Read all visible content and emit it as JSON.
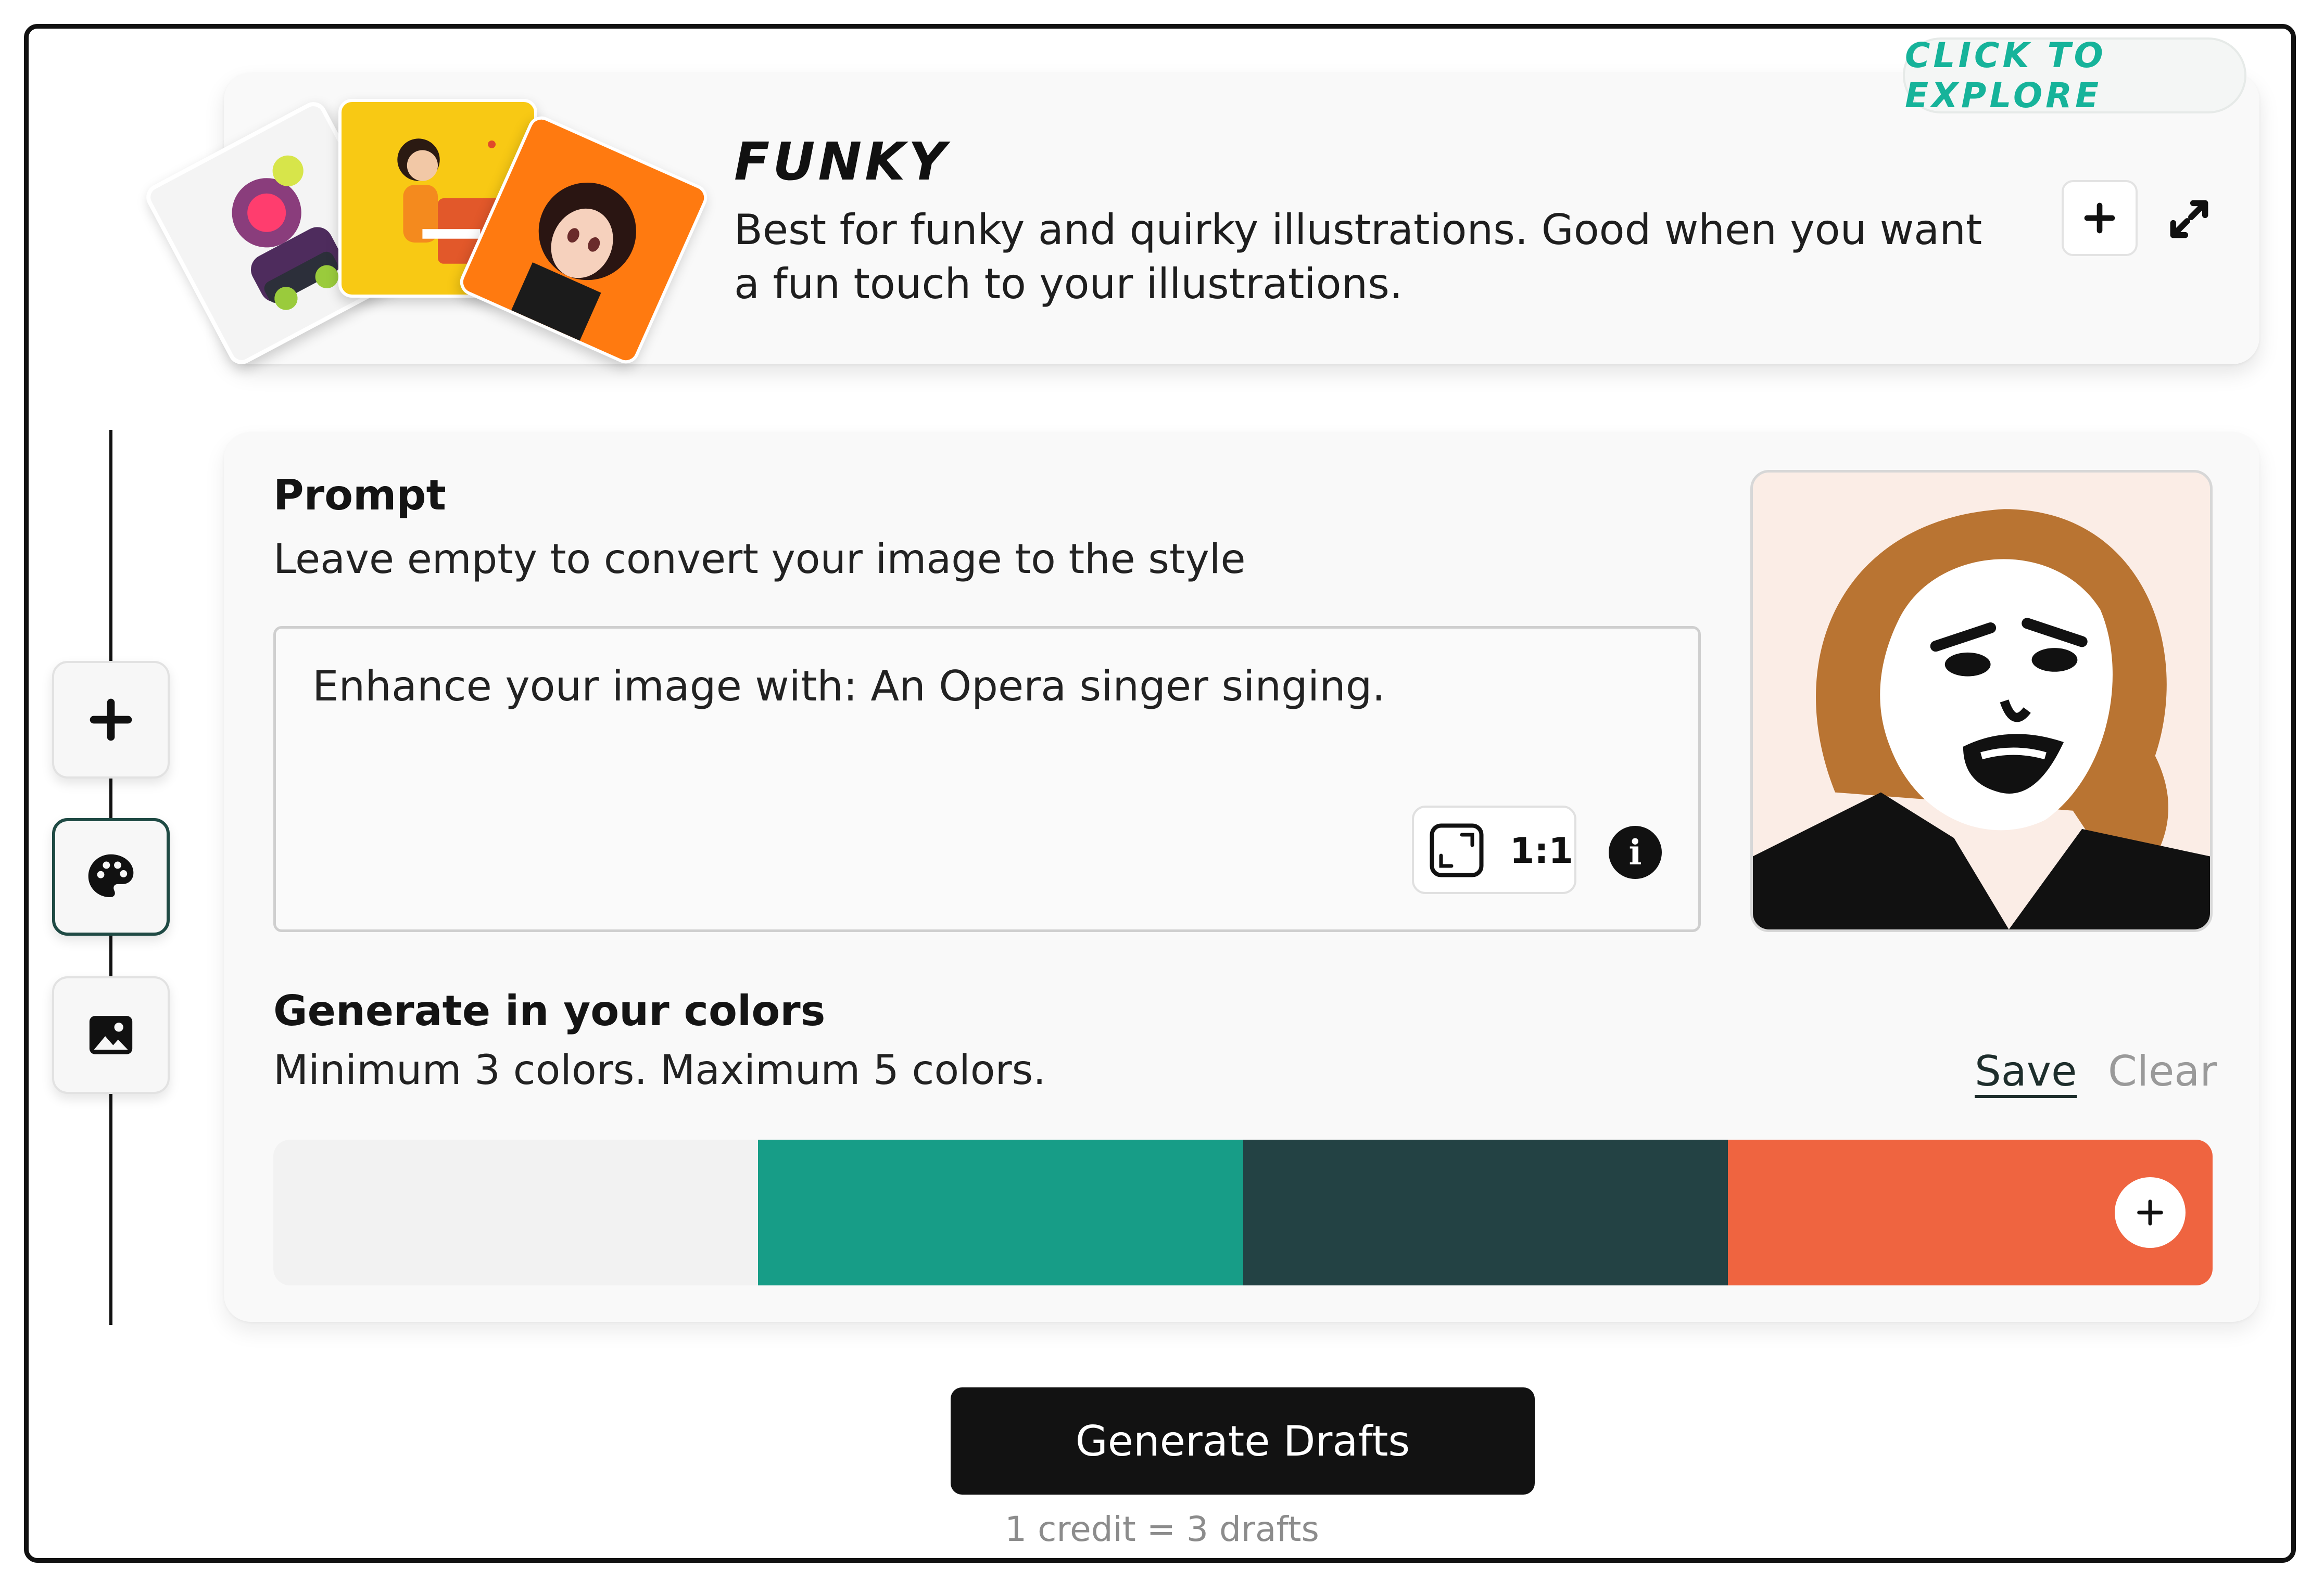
{
  "style": {
    "explore_label": "CLICK TO EXPLORE",
    "name": "FUNKY",
    "description": "Best for funky and quirky illustrations. Good when you want a fun touch to your illustrations.",
    "add_icon": "plus-icon",
    "expand_icon": "expand-icon"
  },
  "rail": {
    "buttons": [
      {
        "icon": "plus-icon"
      },
      {
        "icon": "palette-icon",
        "active": true
      },
      {
        "icon": "image-icon"
      }
    ]
  },
  "prompt": {
    "title": "Prompt",
    "subtitle": "Leave empty to convert your image to the style",
    "value": "Enhance your image with: An Opera singer singing.",
    "aspect_ratio": "1:1",
    "info_icon": "info-icon"
  },
  "colors": {
    "title": "Generate in your colors",
    "subtitle": "Minimum 3 colors. Maximum 5 colors.",
    "save_label": "Save",
    "clear_label": "Clear",
    "swatches": [
      "#f2f2f2",
      "#179d87",
      "#234244",
      "#ef6440"
    ]
  },
  "generate": {
    "label": "Generate Drafts",
    "note": "1 credit = 3 drafts"
  }
}
